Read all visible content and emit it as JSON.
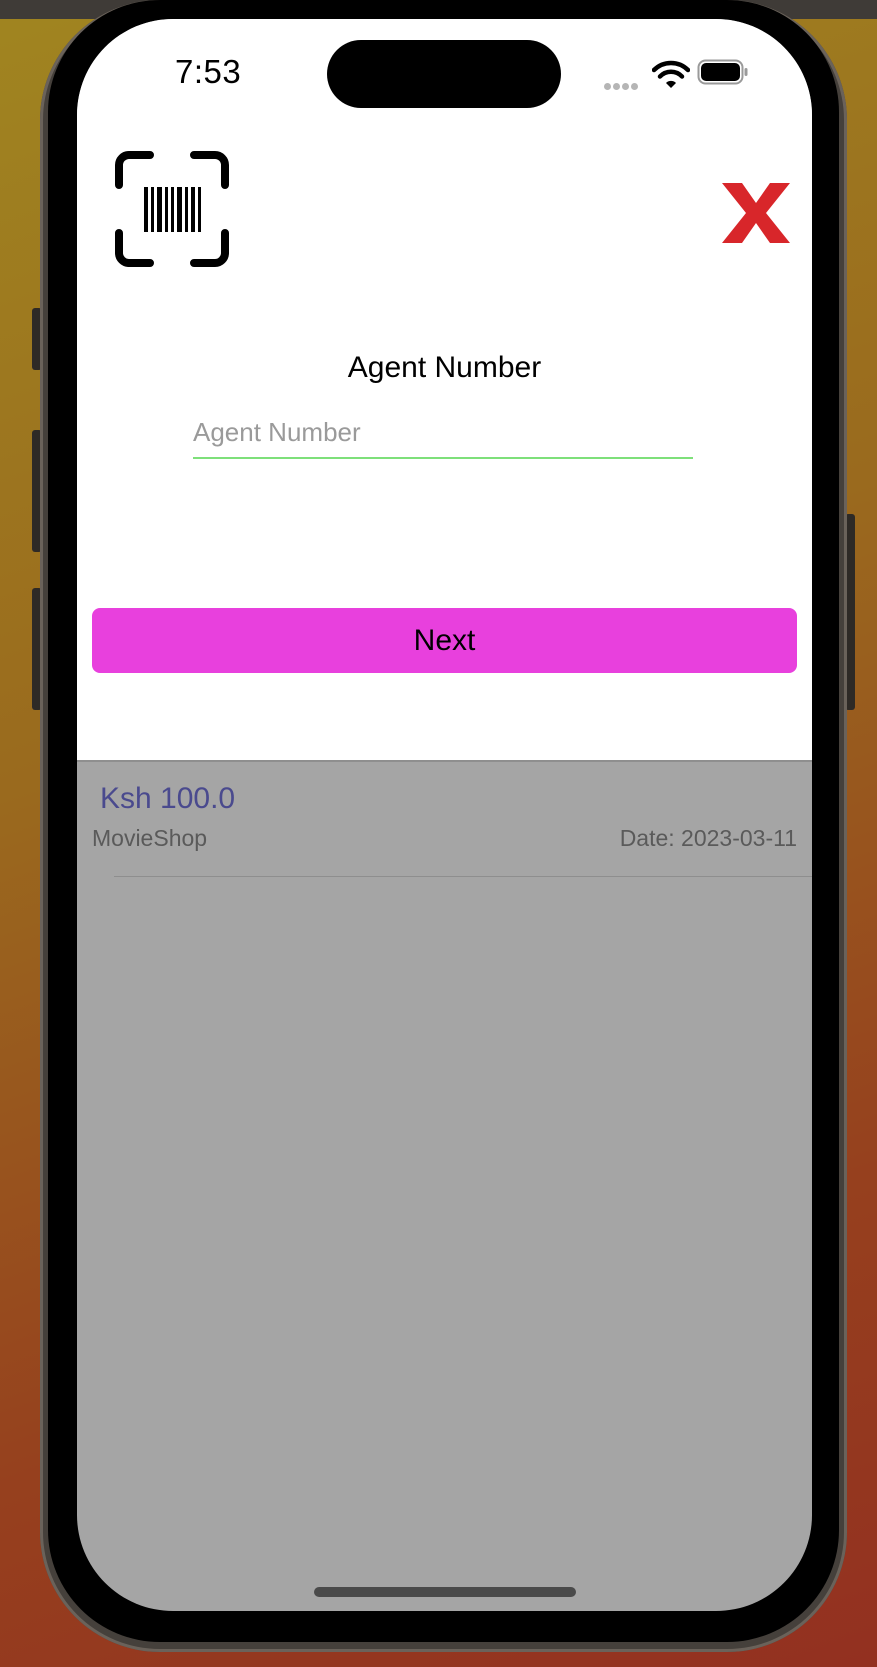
{
  "status_bar": {
    "time": "7:53"
  },
  "header": {
    "scan_icon": "barcode-scan-icon",
    "close_icon": "close-x-icon",
    "close_color": "#d8262a"
  },
  "form": {
    "label": "Agent Number",
    "agent_input": {
      "value": "",
      "placeholder": "Agent Number"
    },
    "next_label": "Next",
    "next_color": "#e840dd"
  },
  "transactions": [
    {
      "amount": "Ksh 100.0",
      "merchant": "MovieShop",
      "date": "Date: 2023-03-11"
    }
  ]
}
